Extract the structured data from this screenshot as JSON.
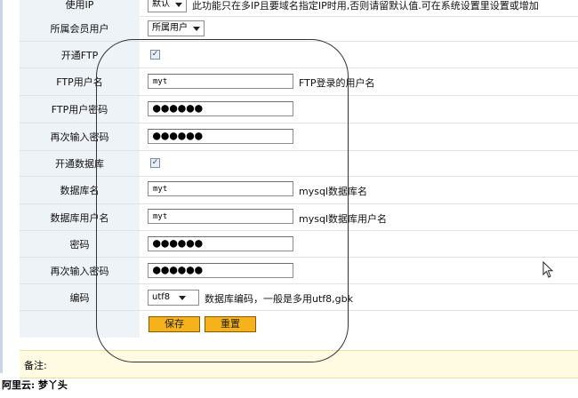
{
  "rows": {
    "ip": {
      "label": "使用IP",
      "select_value": "默认",
      "hint": "此功能只在多IP且要域名指定IP时用,否则请留默认值.可在系统设置里设置或增加"
    },
    "owner": {
      "label": "所属会员用户",
      "select_value": "所属用户"
    },
    "ftp_enable": {
      "label": "开通FTP",
      "checked": true
    },
    "ftp_user": {
      "label": "FTP用户名",
      "value": "myt",
      "hint": "FTP登录的用户名"
    },
    "ftp_pass": {
      "label": "FTP用户密码",
      "value": "●●●●●●"
    },
    "ftp_pass2": {
      "label": "再次输入密码",
      "value": "●●●●●●"
    },
    "db_enable": {
      "label": "开通数据库",
      "checked": true
    },
    "db_name": {
      "label": "数据库名",
      "value": "myt",
      "hint": "mysql数据库名"
    },
    "db_user": {
      "label": "数据库用户名",
      "value": "myt",
      "hint": "mysql数据库用户名"
    },
    "db_pass": {
      "label": "密码",
      "value": "●●●●●●"
    },
    "db_pass2": {
      "label": "再次输入密码",
      "value": "●●●●●●"
    },
    "encoding": {
      "label": "编码",
      "select_value": "utf8",
      "hint": "数据库编码，一般是多用utf8,gbk"
    }
  },
  "buttons": {
    "save": "保存",
    "reset": "重置"
  },
  "note": {
    "label": "备注:"
  },
  "footer": {
    "text": "阿里云: 梦丫头"
  },
  "icons": {
    "check": "checkmark-icon",
    "cursor": "mouse-pointer-icon",
    "dropdown": "dropdown-arrow-icon"
  },
  "colors": {
    "label_bg": "#eef3f8",
    "button": "#f6b21a",
    "note_bg": "#fffbe2"
  }
}
